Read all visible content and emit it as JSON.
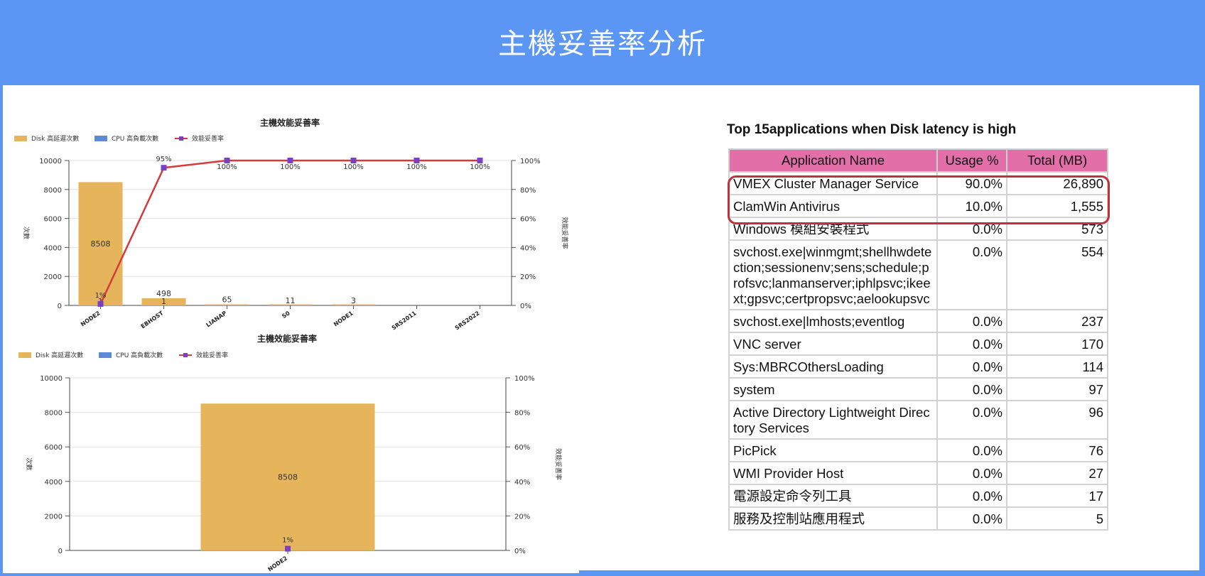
{
  "header": {
    "title": "主機妥善率分析"
  },
  "charts_meta": {
    "legend": [
      "Disk 高延遲次數",
      "CPU 高負載次數",
      "效能妥善率"
    ],
    "ylabel_left": "次數",
    "ylabel_right": "效能妥善率",
    "colors": {
      "disk": "#e6b45a",
      "cpu": "#5b8ad8",
      "line": "#d63a3a",
      "marker": "#7b3fc4"
    }
  },
  "chart_data": [
    {
      "type": "bar",
      "title": "主機效能妥善率",
      "categories": [
        "NODE2",
        "WEBHOST",
        "LIANAP",
        "S0",
        "NODE1",
        "SRS2011",
        "SRS2022"
      ],
      "series": [
        {
          "name": "Disk 高延遲次數",
          "type": "bar",
          "values": [
            8508,
            498,
            65,
            11,
            3,
            0,
            0
          ],
          "labels": [
            "8508",
            "498",
            "65",
            "11",
            "3",
            "",
            ""
          ]
        },
        {
          "name": "CPU 高負載次數",
          "type": "bar",
          "values": [
            0,
            0,
            0,
            0,
            0,
            0,
            0
          ]
        },
        {
          "name": "效能妥善率",
          "type": "line",
          "axis": "right",
          "values": [
            1,
            95,
            100,
            100,
            100,
            100,
            100
          ],
          "labels": [
            "1%",
            "95%",
            "100%",
            "100%",
            "100%",
            "100%",
            "100%"
          ]
        }
      ],
      "ylim": [
        0,
        10000
      ],
      "yticks": [
        "0",
        "2000",
        "4000",
        "6000",
        "8000",
        "10000"
      ],
      "y2lim": [
        0,
        100
      ],
      "y2ticks": [
        "0%",
        "20%",
        "40%",
        "60%",
        "80%",
        "100%"
      ],
      "extra_bar_labels": [
        "1",
        "1"
      ],
      "xlabel_display": [
        "NODE2",
        "EBHOST",
        "LIANAP",
        "S0",
        "NODE1",
        "SRS2011",
        "SRS2022"
      ],
      "legend": "top-left"
    },
    {
      "type": "bar",
      "title": "主機效能妥善率",
      "categories": [
        "NODE2"
      ],
      "series": [
        {
          "name": "Disk 高延遲次數",
          "type": "bar",
          "values": [
            8508
          ],
          "labels": [
            "8508"
          ]
        },
        {
          "name": "CPU 高負載次數",
          "type": "bar",
          "values": [
            0
          ]
        },
        {
          "name": "效能妥善率",
          "type": "line",
          "axis": "right",
          "values": [
            1
          ],
          "labels": [
            "1%"
          ]
        }
      ],
      "ylim": [
        0,
        10000
      ],
      "yticks": [
        "0",
        "2000",
        "4000",
        "6000",
        "8000",
        "10000"
      ],
      "y2lim": [
        0,
        100
      ],
      "y2ticks": [
        "0%",
        "20%",
        "40%",
        "60%",
        "80%",
        "100%"
      ],
      "legend": "top-left"
    }
  ],
  "table": {
    "title": "Top 15applications when Disk latency is high",
    "columns": [
      "Application Name",
      "Usage %",
      "Total (MB)"
    ],
    "rows": [
      {
        "name": "VMEX Cluster Manager Service",
        "usage": "90.0%",
        "total": "26,890"
      },
      {
        "name": "ClamWin Antivirus",
        "usage": "10.0%",
        "total": "1,555"
      },
      {
        "name": "Windows 模組安裝程式",
        "usage": "0.0%",
        "total": "573"
      },
      {
        "name": "svchost.exe|winmgmt;shellhwdetection;sessionenv;sens;schedule;profsvc;lanmanserver;iphlpsvc;ikeext;gpsvc;certpropsvc;aelookupsvc",
        "usage": "0.0%",
        "total": "554"
      },
      {
        "name": "svchost.exe|lmhosts;eventlog",
        "usage": "0.0%",
        "total": "237"
      },
      {
        "name": "VNC server",
        "usage": "0.0%",
        "total": "170"
      },
      {
        "name": "Sys:MBRCOthersLoading",
        "usage": "0.0%",
        "total": "114"
      },
      {
        "name": "system",
        "usage": "0.0%",
        "total": "97"
      },
      {
        "name": "Active Directory Lightweight Directory Services",
        "usage": "0.0%",
        "total": "96"
      },
      {
        "name": "PicPick",
        "usage": "0.0%",
        "total": "76"
      },
      {
        "name": "WMI Provider Host",
        "usage": "0.0%",
        "total": "27"
      },
      {
        "name": "電源設定命令列工具",
        "usage": "0.0%",
        "total": "17"
      },
      {
        "name": "服務及控制站應用程式",
        "usage": "0.0%",
        "total": "5"
      }
    ]
  }
}
